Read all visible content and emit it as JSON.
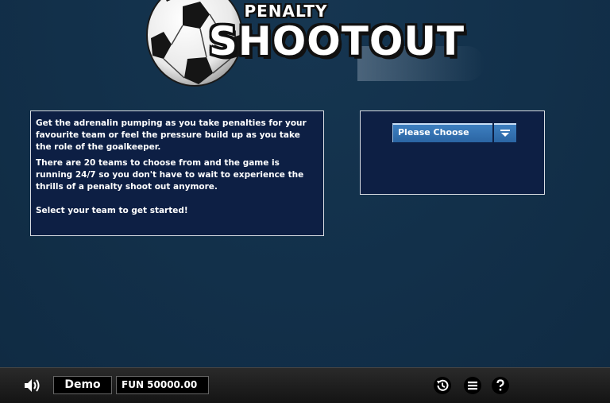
{
  "logo": {
    "top_text": "PENALTY",
    "main_text": "SHOOTOUT"
  },
  "info": {
    "paragraph1": "Get the adrenalin pumping as you take penalties for your favourite team or feel the pressure build up as you take the role of the goalkeeper.",
    "paragraph2": "There are 20 teams to choose from and the game is running 24/7 so you don't have to wait to experience the thrills of a penalty shoot out anymore.",
    "paragraph3": "Select your team to get started!"
  },
  "team_select": {
    "selected": "Please Choose"
  },
  "bottom_bar": {
    "mode": "Demo",
    "balance": "FUN 50000.00",
    "icons": [
      "speaker-icon",
      "history-icon",
      "menu-icon",
      "help-icon"
    ]
  }
}
